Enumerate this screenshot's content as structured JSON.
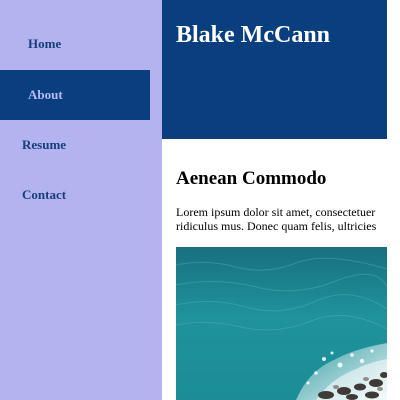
{
  "sidebar": {
    "items": [
      {
        "label": "Home"
      },
      {
        "label": "About"
      },
      {
        "label": "Resume"
      },
      {
        "label": "Contact"
      }
    ],
    "active_item": "About"
  },
  "header": {
    "title": "Blake McCann"
  },
  "main": {
    "heading": "Aenean Commodo",
    "paragraph_line_1": "Lorem ipsum dolor sit amet, consectetuer",
    "paragraph_line_2": "ridiculus mus. Donec quam felis, ultricies"
  },
  "colors": {
    "sidebar_background": "#b3b3f0",
    "header_background": "#0a3f7f",
    "active_nav_background": "#0a3f7f",
    "nav_text": "#173f7a",
    "active_nav_text": "#b9b9f6",
    "ocean_water": "#1f9aa0"
  }
}
